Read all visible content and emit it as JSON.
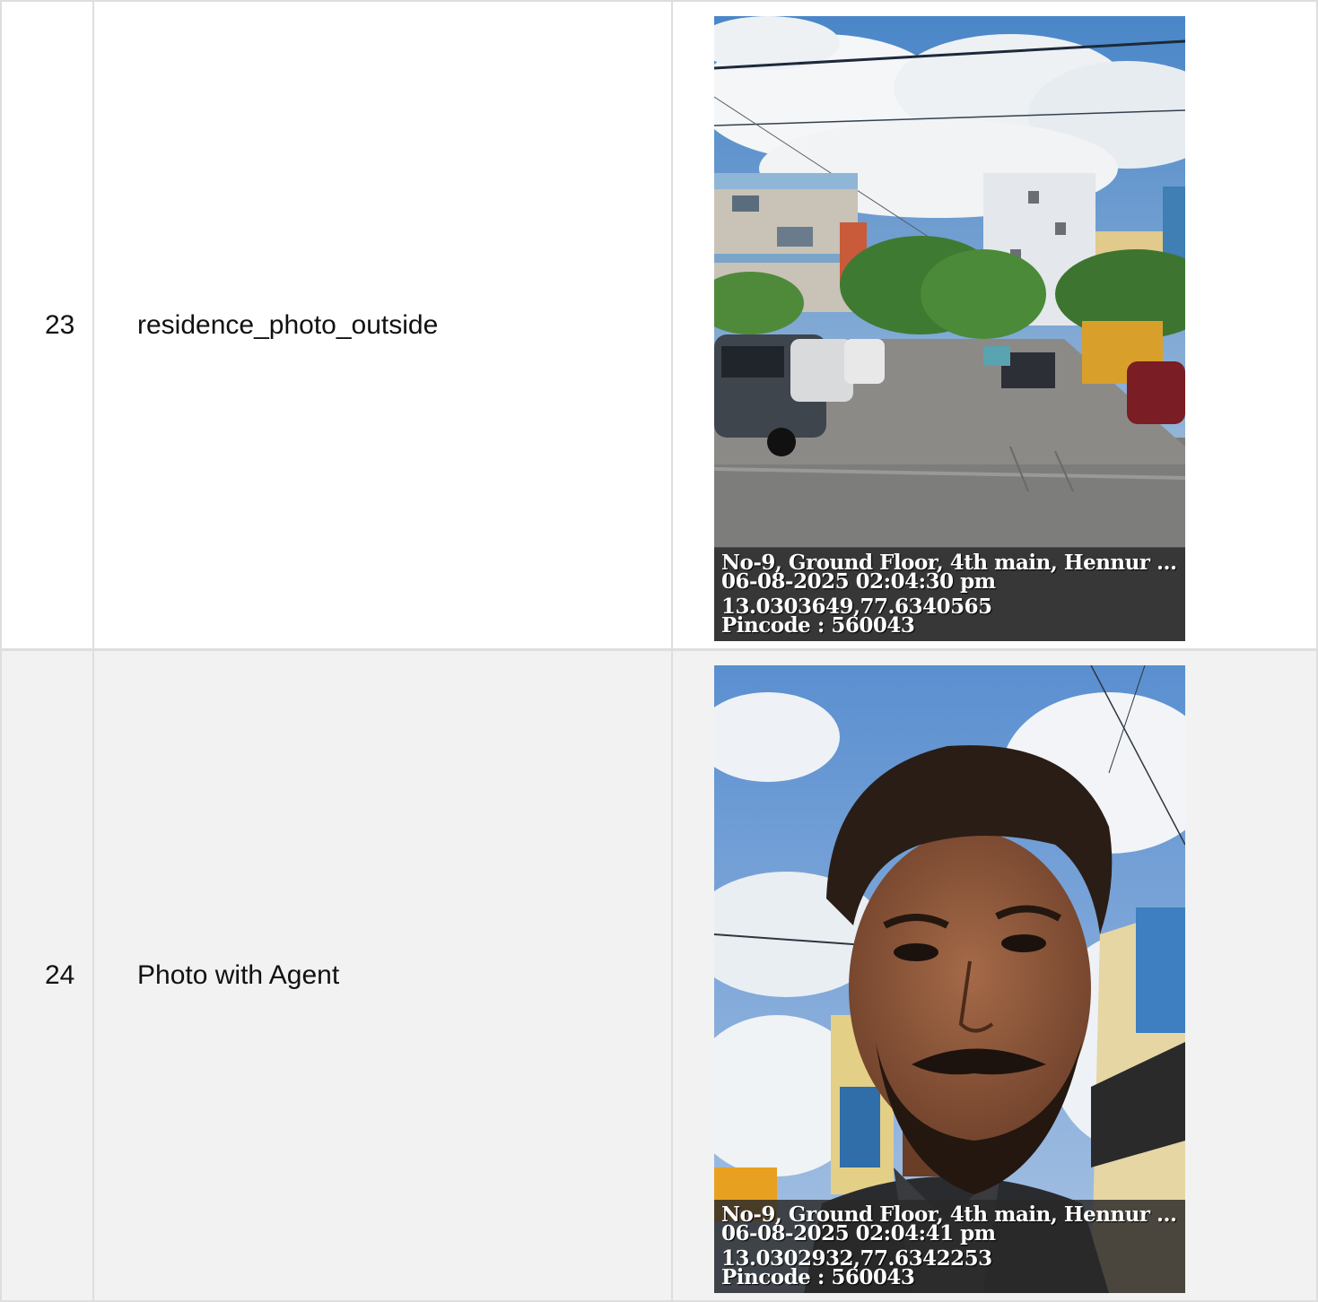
{
  "rows": [
    {
      "number": "23",
      "label": "residence_photo_outside",
      "stamp": {
        "address": "No-9, Ground Floor, 4th main, Hennur ...",
        "datetime": "06-08-2025 02:04:30 pm",
        "coords": "13.0303649,77.6340565",
        "pincode": "Pincode : 560043"
      }
    },
    {
      "number": "24",
      "label": "Photo with Agent",
      "stamp": {
        "address": "No-9, Ground Floor, 4th main, Hennur ...",
        "datetime": "06-08-2025 02:04:41 pm",
        "coords": "13.0302932,77.6342253",
        "pincode": "Pincode : 560043"
      }
    }
  ],
  "colors": {
    "row_even_bg": "#ffffff",
    "row_odd_bg": "#f2f2f2",
    "border": "#dedede"
  }
}
